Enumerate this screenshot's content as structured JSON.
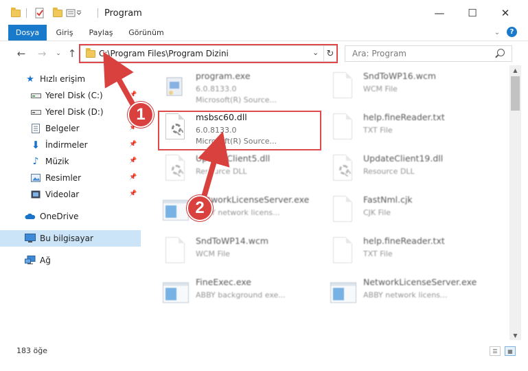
{
  "window": {
    "title": "Program",
    "minimize": "—",
    "maximize": "☐",
    "close": "✕"
  },
  "ribbon": {
    "tabs": [
      "Dosya",
      "Giriş",
      "Paylaş",
      "Görünüm"
    ],
    "help": "?"
  },
  "address": {
    "path": "C:\\Program Files\\Program Dizini",
    "search_placeholder": "Ara: Program"
  },
  "sidebar": {
    "items": [
      {
        "label": "Hızlı erişim",
        "icon": "star-icon",
        "pinned": false
      },
      {
        "label": "Yerel Disk (C:)",
        "icon": "drive-icon",
        "pinned": true
      },
      {
        "label": "Yerel Disk (D:)",
        "icon": "drive-icon",
        "pinned": true
      },
      {
        "label": "Belgeler",
        "icon": "documents-icon",
        "pinned": true
      },
      {
        "label": "İndirmeler",
        "icon": "download-icon",
        "pinned": true
      },
      {
        "label": "Müzik",
        "icon": "music-icon",
        "pinned": true
      },
      {
        "label": "Resimler",
        "icon": "pictures-icon",
        "pinned": true
      },
      {
        "label": "Videolar",
        "icon": "videos-icon",
        "pinned": true
      },
      {
        "label": "OneDrive",
        "icon": "cloud-icon",
        "pinned": false
      },
      {
        "label": "Bu bilgisayar",
        "icon": "computer-icon",
        "pinned": false
      },
      {
        "label": "Ağ",
        "icon": "network-icon",
        "pinned": false
      }
    ]
  },
  "files": [
    {
      "name": "program.exe",
      "l1": "6.0.8133.0",
      "l2": "Microsoft(R) Source...",
      "icon": "exe-setup-icon"
    },
    {
      "name": "SndToWP16.wcm",
      "l1": "WCM File",
      "l2": "",
      "icon": "document-icon"
    },
    {
      "name": "msbsc60.dll",
      "l1": "6.0.8133.0",
      "l2": "Microsoft(R) Source...",
      "icon": "dll-gear-icon"
    },
    {
      "name": "help.fineReader.txt",
      "l1": "TXT File",
      "l2": "",
      "icon": "document-icon"
    },
    {
      "name": "UpdateClient5.dll",
      "l1": "Resource DLL",
      "l2": "",
      "icon": "dll-gear-icon"
    },
    {
      "name": "UpdateClient19.dll",
      "l1": "Resource DLL",
      "l2": "",
      "icon": "dll-gear-icon"
    },
    {
      "name": "NetworkLicenseServer.exe",
      "l1": "ABBY network licens...",
      "l2": "",
      "icon": "exe-window-icon"
    },
    {
      "name": "FastNml.cjk",
      "l1": "CJK File",
      "l2": "",
      "icon": "document-icon"
    },
    {
      "name": "SndToWP14.wcm",
      "l1": "WCM File",
      "l2": "",
      "icon": "document-icon"
    },
    {
      "name": "help.fineReader.txt",
      "l1": "TXT File",
      "l2": "",
      "icon": "document-icon"
    },
    {
      "name": "FineExec.exe",
      "l1": "ABBY background exe...",
      "l2": "",
      "icon": "exe-window-icon"
    },
    {
      "name": "NetworkLicenseServer.exe",
      "l1": "ABBY network licens...",
      "l2": "",
      "icon": "exe-window-icon"
    }
  ],
  "status": {
    "count": "183 öğe"
  },
  "annotations": {
    "badge1": "1",
    "badge2": "2"
  },
  "colors": {
    "accent": "#1979ca",
    "highlight": "#e0494b",
    "selected": "#cce4f7"
  }
}
